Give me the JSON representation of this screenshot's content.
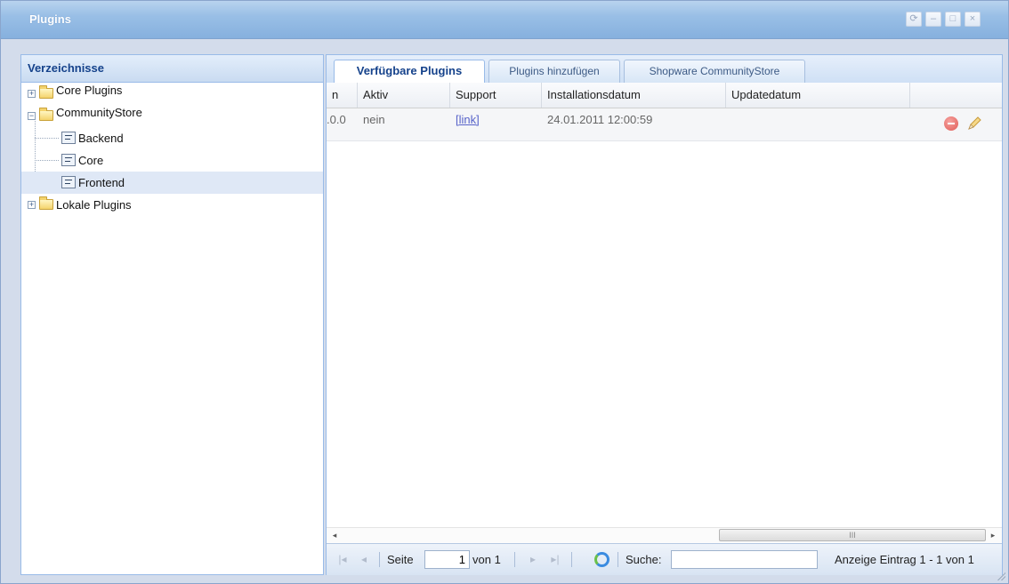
{
  "window": {
    "title": "Plugins",
    "buttons": {
      "refresh": "⟳",
      "minimize": "–",
      "maximize": "□",
      "close": "×"
    }
  },
  "left_panel": {
    "header": "Verzeichnisse",
    "tree": [
      {
        "label": "Core Plugins",
        "type": "folder",
        "expanded": false,
        "icon": "folder-icon"
      },
      {
        "label": "CommunityStore",
        "type": "folder",
        "expanded": true,
        "icon": "folder-open-icon",
        "children": [
          {
            "label": "Backend",
            "icon": "list-page-icon"
          },
          {
            "label": "Core",
            "icon": "list-page-icon"
          },
          {
            "label": "Frontend",
            "icon": "list-page-icon",
            "selected": true
          }
        ]
      },
      {
        "label": "Lokale Plugins",
        "type": "folder",
        "expanded": false,
        "icon": "folder-icon"
      }
    ]
  },
  "tabs": [
    {
      "label": "Verfügbare Plugins",
      "active": true
    },
    {
      "label": "Plugins hinzufügen",
      "active": false
    },
    {
      "label": "Shopware CommunityStore",
      "active": false
    }
  ],
  "grid": {
    "columns": [
      "n",
      "Aktiv",
      "Support",
      "Installationsdatum",
      "Updatedatum",
      ""
    ],
    "rows": [
      {
        "version": ".0.0",
        "aktiv": "nein",
        "support": "[link]",
        "installationsdatum": "24.01.2011 12:00:59",
        "updatedatum": ""
      }
    ],
    "row_actions": [
      "delete-icon",
      "edit-pencil-icon"
    ]
  },
  "scrollbar": {
    "left": "◂",
    "right": "▸",
    "grip": "III"
  },
  "pager": {
    "page_label": "Seite",
    "page_value": "1",
    "of_label": "von 1",
    "search_label": "Suche:",
    "search_value": "",
    "summary": "Anzeige Eintrag 1 - 1 von 1"
  },
  "colors": {
    "titlebar": "#99bfe6",
    "panel_header_text": "#15428b",
    "selected_row": "#dfe8f6",
    "link": "#5763c9",
    "delete": "#e05a55"
  }
}
